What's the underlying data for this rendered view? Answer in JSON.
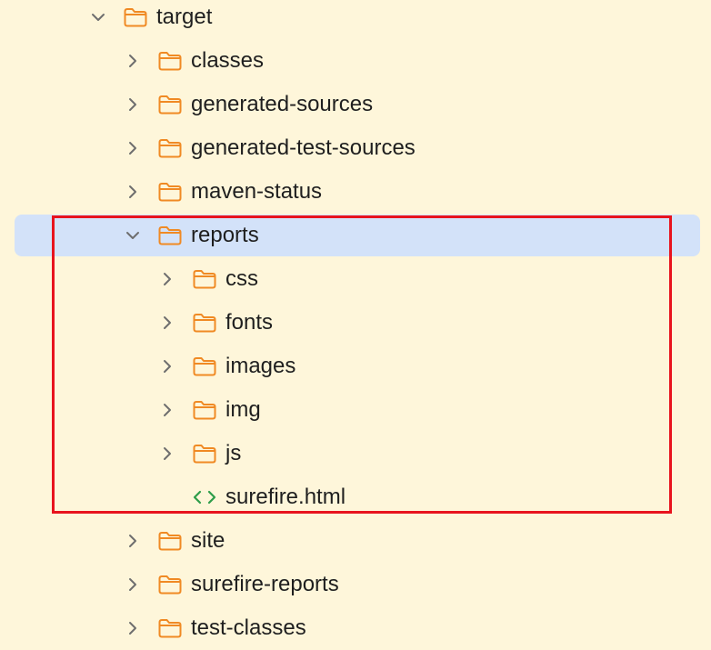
{
  "colors": {
    "background": "#FEF6DA",
    "selection": "#D3E2F9",
    "folder_icon": "#F08A24",
    "html_icon": "#2E9D4A",
    "chevron": "#6E6E6E",
    "highlight_border": "#E8131D"
  },
  "tree": {
    "root": {
      "label": "target",
      "icon": "folder-icon",
      "expanded": true
    },
    "children": [
      {
        "label": "classes",
        "icon": "folder-icon",
        "expanded": false
      },
      {
        "label": "generated-sources",
        "icon": "folder-icon",
        "expanded": false
      },
      {
        "label": "generated-test-sources",
        "icon": "folder-icon",
        "expanded": false
      },
      {
        "label": "maven-status",
        "icon": "folder-icon",
        "expanded": false
      },
      {
        "label": "reports",
        "icon": "folder-icon",
        "expanded": true,
        "selected": true
      },
      {
        "label": "site",
        "icon": "folder-icon",
        "expanded": false
      },
      {
        "label": "surefire-reports",
        "icon": "folder-icon",
        "expanded": false
      },
      {
        "label": "test-classes",
        "icon": "folder-icon",
        "expanded": false
      }
    ],
    "reports_children": [
      {
        "label": "css",
        "icon": "folder-icon",
        "expanded": false
      },
      {
        "label": "fonts",
        "icon": "folder-icon",
        "expanded": false
      },
      {
        "label": "images",
        "icon": "folder-icon",
        "expanded": false
      },
      {
        "label": "img",
        "icon": "folder-icon",
        "expanded": false
      },
      {
        "label": "js",
        "icon": "folder-icon",
        "expanded": false
      },
      {
        "label": "surefire.html",
        "icon": "html-file-icon"
      }
    ]
  }
}
